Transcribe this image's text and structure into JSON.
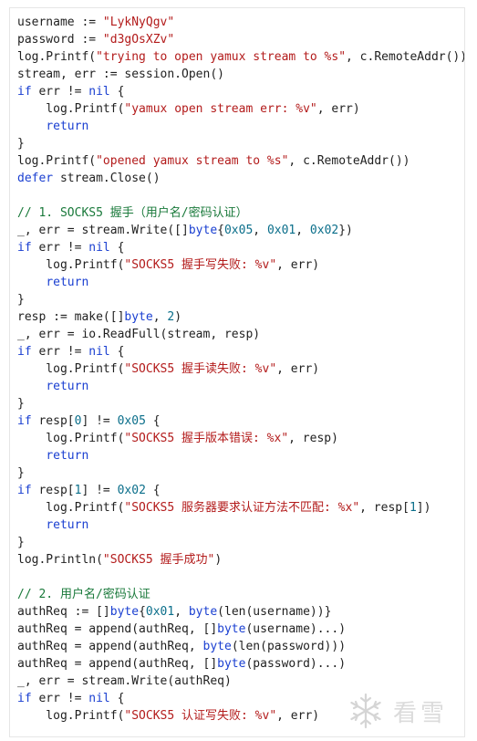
{
  "colors": {
    "string": "#b31b1b",
    "number": "#0a6e8a",
    "keyword": "#1a3fd1",
    "comment": "#19793a",
    "text": "#1f1f1f"
  },
  "code_lines": [
    [
      [
        "t",
        "username := "
      ],
      [
        "s",
        "\"LykNyQgv\""
      ]
    ],
    [
      [
        "t",
        "password := "
      ],
      [
        "s",
        "\"d3gOsXZv\""
      ]
    ],
    [
      [
        "t",
        "log.Printf("
      ],
      [
        "s",
        "\"trying to open yamux stream to %s\""
      ],
      [
        "t",
        ", c.RemoteAddr())"
      ]
    ],
    [
      [
        "t",
        "stream, err := session.Open()"
      ]
    ],
    [
      [
        "k",
        "if"
      ],
      [
        "t",
        " err != "
      ],
      [
        "k",
        "nil"
      ],
      [
        "t",
        " {"
      ]
    ],
    [
      [
        "t",
        "    log.Printf("
      ],
      [
        "s",
        "\"yamux open stream err: %v\""
      ],
      [
        "t",
        ", err)"
      ]
    ],
    [
      [
        "t",
        "    "
      ],
      [
        "k",
        "return"
      ]
    ],
    [
      [
        "t",
        "}"
      ]
    ],
    [
      [
        "t",
        "log.Printf("
      ],
      [
        "s",
        "\"opened yamux stream to %s\""
      ],
      [
        "t",
        ", c.RemoteAddr())"
      ]
    ],
    [
      [
        "k",
        "defer"
      ],
      [
        "t",
        " stream.Close()"
      ]
    ],
    [
      [
        "t",
        ""
      ]
    ],
    [
      [
        "c",
        "// 1. SOCKS5 握手（用户名/密码认证）"
      ]
    ],
    [
      [
        "t",
        "_, err = stream.Write([]"
      ],
      [
        "k",
        "byte"
      ],
      [
        "t",
        "{"
      ],
      [
        "n",
        "0x05"
      ],
      [
        "t",
        ", "
      ],
      [
        "n",
        "0x01"
      ],
      [
        "t",
        ", "
      ],
      [
        "n",
        "0x02"
      ],
      [
        "t",
        "})"
      ]
    ],
    [
      [
        "k",
        "if"
      ],
      [
        "t",
        " err != "
      ],
      [
        "k",
        "nil"
      ],
      [
        "t",
        " {"
      ]
    ],
    [
      [
        "t",
        "    log.Printf("
      ],
      [
        "s",
        "\"SOCKS5 握手写失败: %v\""
      ],
      [
        "t",
        ", err)"
      ]
    ],
    [
      [
        "t",
        "    "
      ],
      [
        "k",
        "return"
      ]
    ],
    [
      [
        "t",
        "}"
      ]
    ],
    [
      [
        "t",
        "resp := make([]"
      ],
      [
        "k",
        "byte"
      ],
      [
        "t",
        ", "
      ],
      [
        "n",
        "2"
      ],
      [
        "t",
        ")"
      ]
    ],
    [
      [
        "t",
        "_, err = io.ReadFull(stream, resp)"
      ]
    ],
    [
      [
        "k",
        "if"
      ],
      [
        "t",
        " err != "
      ],
      [
        "k",
        "nil"
      ],
      [
        "t",
        " {"
      ]
    ],
    [
      [
        "t",
        "    log.Printf("
      ],
      [
        "s",
        "\"SOCKS5 握手读失败: %v\""
      ],
      [
        "t",
        ", err)"
      ]
    ],
    [
      [
        "t",
        "    "
      ],
      [
        "k",
        "return"
      ]
    ],
    [
      [
        "t",
        "}"
      ]
    ],
    [
      [
        "k",
        "if"
      ],
      [
        "t",
        " resp["
      ],
      [
        "n",
        "0"
      ],
      [
        "t",
        "] != "
      ],
      [
        "n",
        "0x05"
      ],
      [
        "t",
        " {"
      ]
    ],
    [
      [
        "t",
        "    log.Printf("
      ],
      [
        "s",
        "\"SOCKS5 握手版本错误: %x\""
      ],
      [
        "t",
        ", resp)"
      ]
    ],
    [
      [
        "t",
        "    "
      ],
      [
        "k",
        "return"
      ]
    ],
    [
      [
        "t",
        "}"
      ]
    ],
    [
      [
        "k",
        "if"
      ],
      [
        "t",
        " resp["
      ],
      [
        "n",
        "1"
      ],
      [
        "t",
        "] != "
      ],
      [
        "n",
        "0x02"
      ],
      [
        "t",
        " {"
      ]
    ],
    [
      [
        "t",
        "    log.Printf("
      ],
      [
        "s",
        "\"SOCKS5 服务器要求认证方法不匹配: %x\""
      ],
      [
        "t",
        ", resp["
      ],
      [
        "n",
        "1"
      ],
      [
        "t",
        "])"
      ]
    ],
    [
      [
        "t",
        "    "
      ],
      [
        "k",
        "return"
      ]
    ],
    [
      [
        "t",
        "}"
      ]
    ],
    [
      [
        "t",
        "log.Println("
      ],
      [
        "s",
        "\"SOCKS5 握手成功\""
      ],
      [
        "t",
        ")"
      ]
    ],
    [
      [
        "t",
        ""
      ]
    ],
    [
      [
        "c",
        "// 2. 用户名/密码认证"
      ]
    ],
    [
      [
        "t",
        "authReq := []"
      ],
      [
        "k",
        "byte"
      ],
      [
        "t",
        "{"
      ],
      [
        "n",
        "0x01"
      ],
      [
        "t",
        ", "
      ],
      [
        "k",
        "byte"
      ],
      [
        "t",
        "(len(username))}"
      ]
    ],
    [
      [
        "t",
        "authReq = append(authReq, []"
      ],
      [
        "k",
        "byte"
      ],
      [
        "t",
        "(username)...)"
      ]
    ],
    [
      [
        "t",
        "authReq = append(authReq, "
      ],
      [
        "k",
        "byte"
      ],
      [
        "t",
        "(len(password)))"
      ]
    ],
    [
      [
        "t",
        "authReq = append(authReq, []"
      ],
      [
        "k",
        "byte"
      ],
      [
        "t",
        "(password)...)"
      ]
    ],
    [
      [
        "t",
        "_, err = stream.Write(authReq)"
      ]
    ],
    [
      [
        "k",
        "if"
      ],
      [
        "t",
        " err != "
      ],
      [
        "k",
        "nil"
      ],
      [
        "t",
        " {"
      ]
    ],
    [
      [
        "t",
        "    log.Printf("
      ],
      [
        "s",
        "\"SOCKS5 认证写失败: %v\""
      ],
      [
        "t",
        ", err)"
      ]
    ]
  ],
  "watermark": {
    "icon": "snowflake-logo-icon",
    "text": "看雪"
  }
}
